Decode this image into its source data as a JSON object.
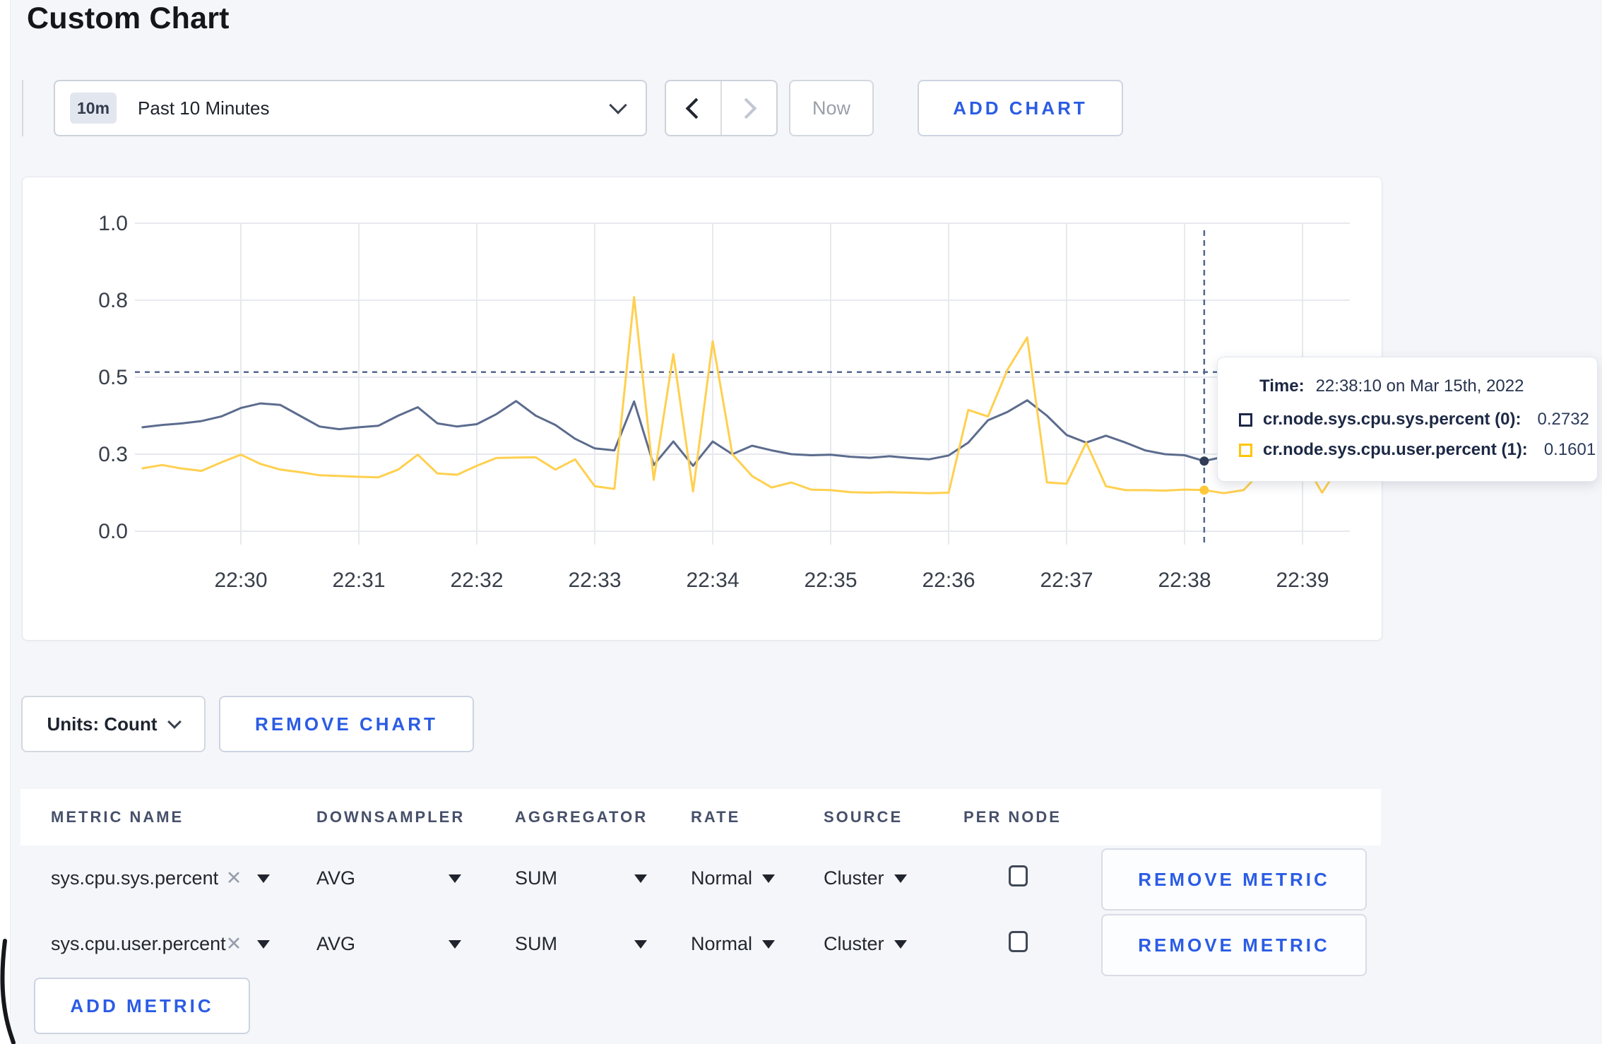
{
  "page": {
    "title": "Custom Chart"
  },
  "toolbar": {
    "range_badge": "10m",
    "range_label": "Past 10 Minutes",
    "now_label": "Now",
    "add_chart_label": "ADD CHART"
  },
  "chart_data": {
    "type": "line",
    "title": "",
    "xlabel": "",
    "ylabel": "",
    "grid": true,
    "legend_position": "tooltip",
    "x_axis": {
      "tick_labels": [
        "22:30",
        "22:31",
        "22:32",
        "22:33",
        "22:34",
        "22:35",
        "22:36",
        "22:37",
        "22:38",
        "22:39"
      ],
      "first_tick_at_seconds": 50,
      "tick_interval_seconds": 60
    },
    "y_axis": {
      "ticks": [
        0.0,
        0.3,
        0.5,
        0.8,
        1.0
      ],
      "tick_labels": [
        "0.0",
        "0.3",
        "0.5",
        "0.8",
        "1.0"
      ],
      "range": [
        0.0,
        1.0
      ]
    },
    "start_time_label": "22:29:10",
    "sample_step_seconds": 10,
    "series": [
      {
        "name": "cr.node.sys.cpu.sys.percent",
        "color": "#5c6c8e",
        "values": [
          0.37,
          0.376,
          0.38,
          0.386,
          0.398,
          0.42,
          0.432,
          0.428,
          0.4,
          0.372,
          0.365,
          0.37,
          0.374,
          0.4,
          0.422,
          0.38,
          0.372,
          0.378,
          0.404,
          0.438,
          0.4,
          0.376,
          0.34,
          0.315,
          0.31,
          0.437,
          0.258,
          0.333,
          0.255,
          0.333,
          0.3,
          0.322,
          0.31,
          0.3,
          0.296,
          0.298,
          0.29,
          0.286,
          0.292,
          0.285,
          0.28,
          0.295,
          0.33,
          0.388,
          0.41,
          0.44,
          0.4,
          0.35,
          0.33,
          0.348,
          0.33,
          0.31,
          0.3,
          0.296,
          0.2732,
          0.29,
          0.312,
          0.31,
          0.3,
          0.296,
          0.3,
          0.306
        ]
      },
      {
        "name": "cr.node.sys.cpu.user.percent",
        "color": "#ffd04f",
        "values": [
          0.245,
          0.258,
          0.244,
          0.235,
          0.268,
          0.298,
          0.262,
          0.24,
          0.23,
          0.218,
          0.215,
          0.212,
          0.21,
          0.24,
          0.298,
          0.225,
          0.22,
          0.255,
          0.285,
          0.287,
          0.288,
          0.24,
          0.28,
          0.175,
          0.165,
          0.808,
          0.2,
          0.59,
          0.155,
          0.64,
          0.3,
          0.215,
          0.17,
          0.19,
          0.162,
          0.16,
          0.152,
          0.15,
          0.152,
          0.15,
          0.148,
          0.15,
          0.415,
          0.398,
          0.53,
          0.655,
          0.19,
          0.185,
          0.33,
          0.175,
          0.16,
          0.16,
          0.158,
          0.162,
          0.1601,
          0.148,
          0.16,
          0.24,
          0.305,
          0.28,
          0.15,
          0.27
        ]
      }
    ],
    "guide_value": 0.52,
    "crosshair": {
      "seconds_from_start": 540,
      "values": [
        0.2732,
        0.1601
      ]
    }
  },
  "tooltip": {
    "time_label": "Time:",
    "time_value": "22:38:10 on Mar 15th, 2022",
    "rows": [
      {
        "label": "cr.node.sys.cpu.sys.percent (0):",
        "value": "0.2732",
        "color": "#1b2947"
      },
      {
        "label": "cr.node.sys.cpu.user.percent (1):",
        "value": "0.1601",
        "color": "#ffc503"
      }
    ]
  },
  "chart_actions": {
    "units_label": "Units: Count",
    "remove_chart_label": "REMOVE CHART"
  },
  "metrics_table": {
    "headers": [
      "METRIC NAME",
      "DOWNSAMPLER",
      "AGGREGATOR",
      "RATE",
      "SOURCE",
      "PER NODE"
    ],
    "clear_glyph": "✕",
    "rows": [
      {
        "metric": "sys.cpu.sys.percent",
        "downsampler": "AVG",
        "aggregator": "SUM",
        "rate": "Normal",
        "source": "Cluster",
        "per_node_checked": false,
        "remove_label": "REMOVE METRIC"
      },
      {
        "metric": "sys.cpu.user.percent",
        "downsampler": "AVG",
        "aggregator": "SUM",
        "rate": "Normal",
        "source": "Cluster",
        "per_node_checked": false,
        "remove_label": "REMOVE METRIC"
      }
    ],
    "add_metric_label": "ADD METRIC"
  },
  "colors": {
    "accent": "#2b5ce5",
    "page_bg": "#f5f6f9",
    "card_border": "#e4e7ed",
    "grid_line": "#e7e9ee",
    "crosshair": "#54678d",
    "series_sys": "#5c6c8e",
    "series_user": "#ffd04f"
  }
}
